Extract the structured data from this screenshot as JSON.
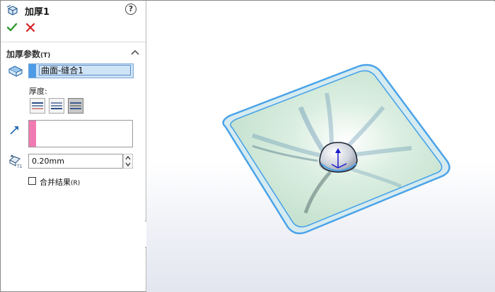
{
  "panel": {
    "title": "加厚1",
    "help_label": "?",
    "ok_icon": "checkmark-icon",
    "cancel_icon": "close-icon",
    "section": {
      "title": "加厚参数",
      "hotkey": "(T)"
    },
    "selection": {
      "item": "曲面-缝合1",
      "color": "#4d9be6"
    },
    "thickness_label": "厚度:",
    "thicken_sides": [
      "side-1-icon",
      "side-2-icon",
      "both-sides-icon"
    ],
    "active_side": "both-sides-icon",
    "direction_color": "#f07bb2",
    "thickness_value": "0.20mm",
    "merge": {
      "label": "合并结果",
      "hotkey": "(R)",
      "checked": false
    }
  },
  "viewport": {
    "surface_color": "#c9e3d3",
    "edge_color": "#4aa3e8"
  }
}
